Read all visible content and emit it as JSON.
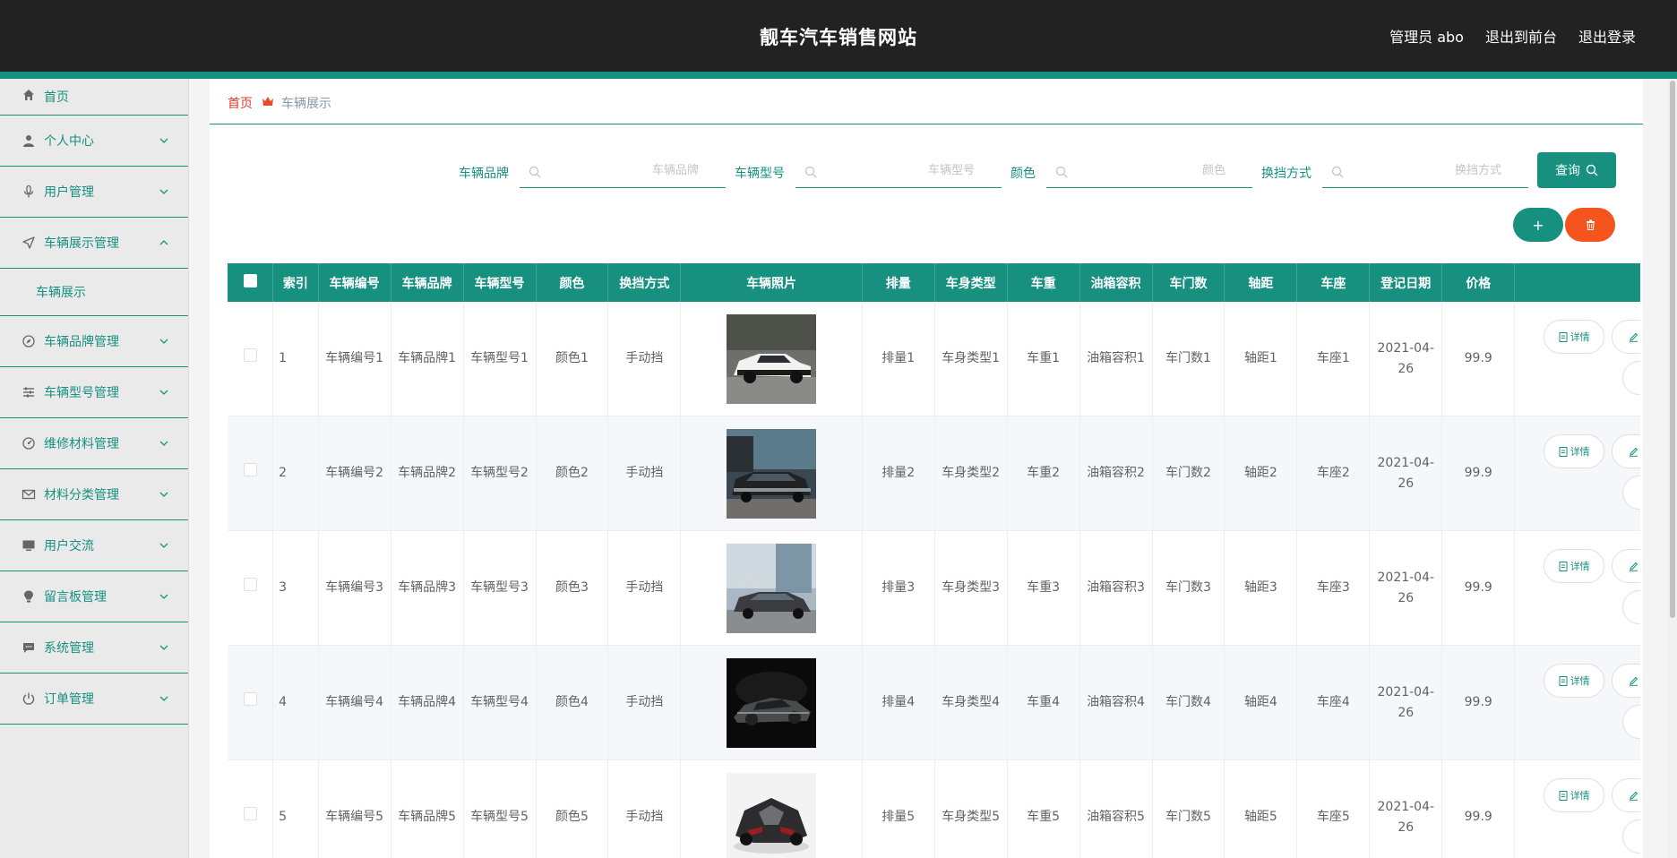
{
  "header": {
    "title": "靓车汽车销售网站",
    "user_label": "管理员 abo",
    "to_front": "退出到前台",
    "logout": "退出登录"
  },
  "sidebar": {
    "items": [
      {
        "label": "首页",
        "icon": "home-icon"
      },
      {
        "label": "个人中心",
        "icon": "user-icon"
      },
      {
        "label": "用户管理",
        "icon": "microphone-icon"
      },
      {
        "label": "车辆展示管理",
        "icon": "send-icon",
        "expanded": true,
        "children": [
          "车辆展示"
        ]
      },
      {
        "label": "车辆品牌管理",
        "icon": "compass-icon"
      },
      {
        "label": "车辆型号管理",
        "icon": "list-icon"
      },
      {
        "label": "维修材料管理",
        "icon": "gauge-icon"
      },
      {
        "label": "材料分类管理",
        "icon": "mail-icon"
      },
      {
        "label": "用户交流",
        "icon": "monitor-icon"
      },
      {
        "label": "留言板管理",
        "icon": "bulb-icon"
      },
      {
        "label": "系统管理",
        "icon": "chat-icon"
      },
      {
        "label": "订单管理",
        "icon": "power-icon"
      }
    ]
  },
  "breadcrumb": {
    "home": "首页",
    "current": "车辆展示"
  },
  "search": {
    "brand_label": "车辆品牌",
    "brand_placeholder": "车辆品牌",
    "model_label": "车辆型号",
    "model_placeholder": "车辆型号",
    "color_label": "颜色",
    "color_placeholder": "颜色",
    "gear_label": "换挡方式",
    "gear_placeholder": "换挡方式",
    "query_label": "查询"
  },
  "toolbar": {
    "add_label": "+"
  },
  "table": {
    "headers": [
      "索引",
      "车辆编号",
      "车辆品牌",
      "车辆型号",
      "颜色",
      "换挡方式",
      "车辆照片",
      "排量",
      "车身类型",
      "车重",
      "油箱容积",
      "车门数",
      "轴距",
      "车座",
      "登记日期",
      "价格"
    ],
    "rows": [
      [
        "1",
        "车辆编号1",
        "车辆品牌1",
        "车辆型号1",
        "颜色1",
        "手动挡",
        "",
        "排量1",
        "车身类型1",
        "车重1",
        "油箱容积1",
        "车门数1",
        "轴距1",
        "车座1",
        "2021-04-26",
        "99.9"
      ],
      [
        "2",
        "车辆编号2",
        "车辆品牌2",
        "车辆型号2",
        "颜色2",
        "手动挡",
        "",
        "排量2",
        "车身类型2",
        "车重2",
        "油箱容积2",
        "车门数2",
        "轴距2",
        "车座2",
        "2021-04-26",
        "99.9"
      ],
      [
        "3",
        "车辆编号3",
        "车辆品牌3",
        "车辆型号3",
        "颜色3",
        "手动挡",
        "",
        "排量3",
        "车身类型3",
        "车重3",
        "油箱容积3",
        "车门数3",
        "轴距3",
        "车座3",
        "2021-04-26",
        "99.9"
      ],
      [
        "4",
        "车辆编号4",
        "车辆品牌4",
        "车辆型号4",
        "颜色4",
        "手动挡",
        "",
        "排量4",
        "车身类型4",
        "车重4",
        "油箱容积4",
        "车门数4",
        "轴距4",
        "车座4",
        "2021-04-26",
        "99.9"
      ],
      [
        "5",
        "车辆编号5",
        "车辆品牌5",
        "车辆型号5",
        "颜色5",
        "手动挡",
        "",
        "排量5",
        "车身类型5",
        "车重5",
        "油箱容积5",
        "车门数5",
        "轴距5",
        "车座5",
        "2021-04-26",
        "99.9"
      ]
    ],
    "detail_label": "详情"
  },
  "colors": {
    "accent": "#179080",
    "danger": "#f5541c",
    "header": "#222222",
    "crumb_home": "#e03a2f"
  }
}
